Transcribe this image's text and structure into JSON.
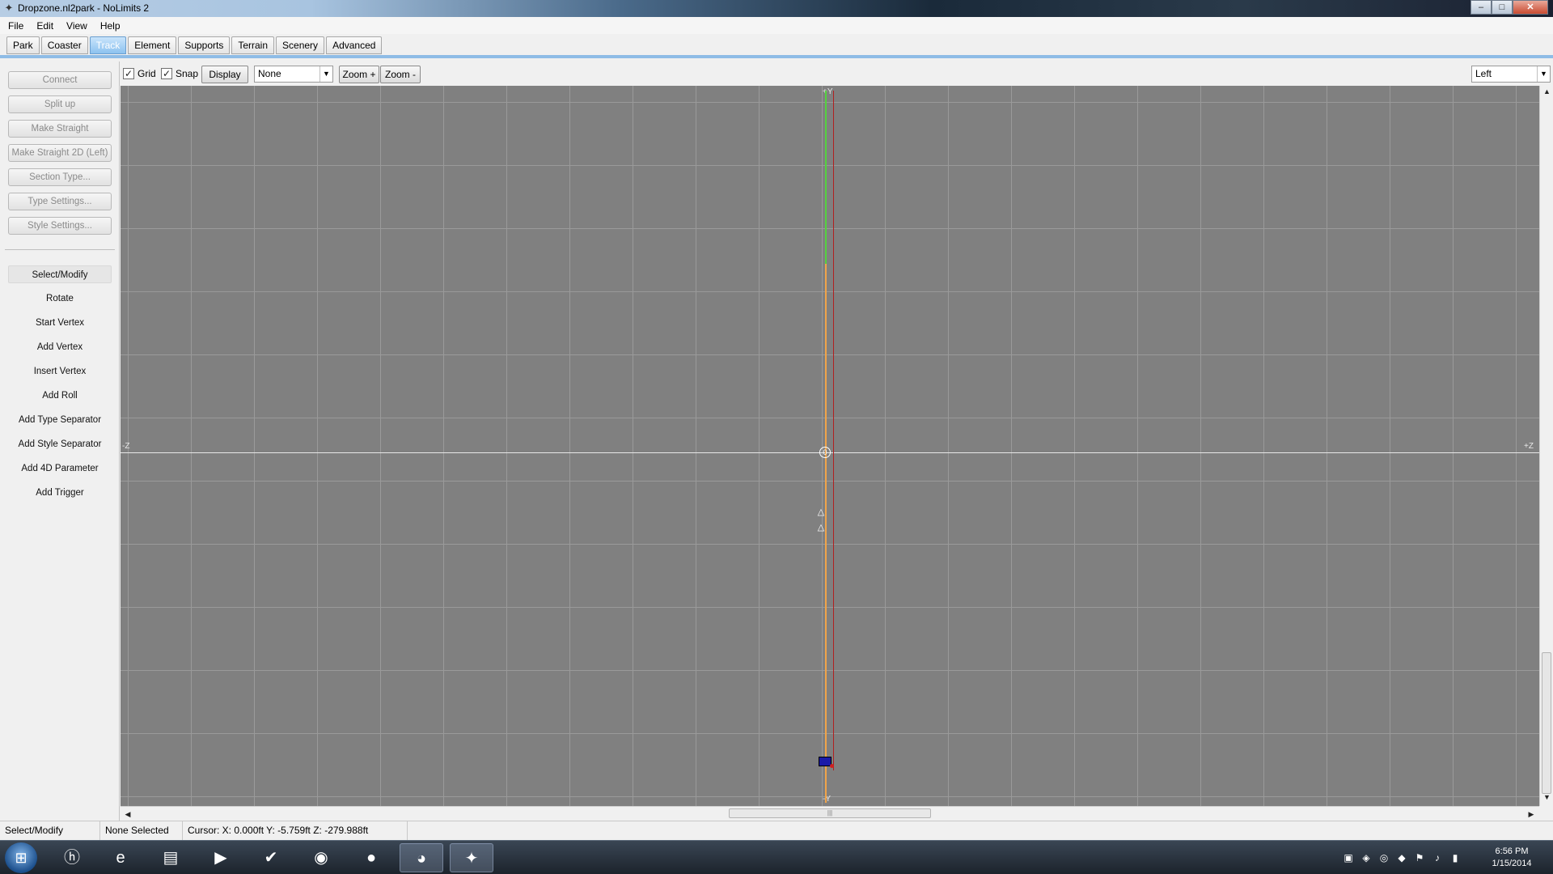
{
  "window": {
    "title": "Dropzone.nl2park - NoLimits 2",
    "minimize": "–",
    "maximize": "□",
    "close": "✕"
  },
  "menu": [
    "File",
    "Edit",
    "View",
    "Help"
  ],
  "tabs": [
    {
      "label": "Park",
      "active": false
    },
    {
      "label": "Coaster",
      "active": false
    },
    {
      "label": "Track",
      "active": true
    },
    {
      "label": "Element",
      "active": false
    },
    {
      "label": "Supports",
      "active": false
    },
    {
      "label": "Terrain",
      "active": false
    },
    {
      "label": "Scenery",
      "active": false
    },
    {
      "label": "Advanced",
      "active": false
    }
  ],
  "left_panel": {
    "buttons": [
      "Connect",
      "Split up",
      "Make Straight",
      "Make Straight 2D (Left)",
      "Section Type...",
      "Type Settings...",
      "Style Settings..."
    ],
    "tools": [
      "Select/Modify",
      "Rotate",
      "Start Vertex",
      "Add Vertex",
      "Insert Vertex",
      "Add Roll",
      "Add Type Separator",
      "Add Style Separator",
      "Add 4D Parameter",
      "Add Trigger"
    ],
    "active_tool": "Select/Modify"
  },
  "toolbar": {
    "grid_label": "Grid",
    "grid_checked": true,
    "snap_label": "Snap",
    "snap_checked": true,
    "display_label": "Display",
    "display_select": "None",
    "zoom_in_label": "Zoom +",
    "zoom_out_label": "Zoom -",
    "view_select": "Left"
  },
  "viewport": {
    "axis_top": "+Y",
    "axis_bottom": "-Y",
    "axis_left": "-Z",
    "axis_right": "+Z",
    "colors": {
      "background": "#808080",
      "track": "#f0a44a",
      "selected_segment": "#55d040",
      "secondary_rail": "#b02020",
      "car": "#1a1aa8"
    }
  },
  "status": {
    "mode": "Select/Modify",
    "selection": "None Selected",
    "cursor": "Cursor: X: 0.000ft Y: -5.759ft Z: -279.988ft"
  },
  "taskbar": {
    "apps": [
      "hp-icon",
      "ie-icon",
      "explorer-icon",
      "media-player-icon",
      "tasks-icon",
      "browser-icon",
      "game-icon",
      "firefox-icon",
      "nolimits-icon"
    ],
    "clock_time": "6:56 PM",
    "clock_date": "1/15/2014"
  }
}
